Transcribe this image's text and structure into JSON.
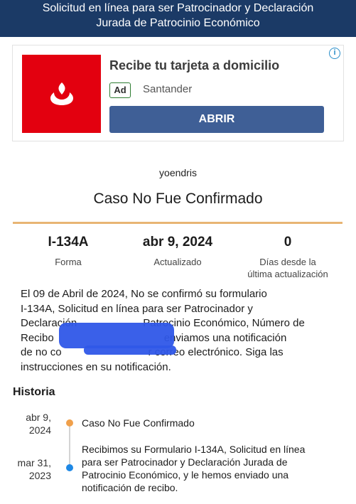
{
  "header": {
    "title_line1": "Solicitud en línea para ser Patrocinador y Declaración",
    "title_line2": "Jurada de Patrocinio Económico"
  },
  "ad": {
    "title": "Recibe tu tarjeta a domicilio",
    "badge": "Ad",
    "brand": "Santander",
    "button_label": "ABRIR",
    "info_icon": "i",
    "logo_color": "#e3000f",
    "button_color": "#3f5f96"
  },
  "case": {
    "username": "yoendris",
    "status_title": "Caso No Fue Confirmado",
    "accent_color": "#e8b574"
  },
  "stats": [
    {
      "value": "I-134A",
      "label": "Forma"
    },
    {
      "value": "abr 9, 2024",
      "label": "Actualizado"
    },
    {
      "value": "0",
      "label_line1": "Días desde la",
      "label_line2": "última actualización"
    }
  ],
  "description": {
    "line1": "El 09 de Abril de 2024, No se confirmó su formulario",
    "line2": "I-134A, Solicitud en línea para ser Patrocinador y",
    "line3_a": "Declaración",
    "line3_b": "Patrocinio Económico, Número de",
    "line4_a": "Recibo",
    "line4_b": "enviamos una notificación",
    "line5_a": "de no co",
    "line5_b": "r correo electrónico. Siga las",
    "line6": "instrucciones en su notificación."
  },
  "history": {
    "heading": "Historia",
    "items": [
      {
        "date_line1": "abr 9,",
        "date_line2": "2024",
        "text": "Caso No Fue Confirmado",
        "dot_color": "#f0a04b"
      },
      {
        "date_line1": "mar 31,",
        "date_line2": "2023",
        "text_line1": "Recibimos su Formulario I-134A, Solicitud en línea",
        "text_line2": "para ser Patrocinador y Declaración Jurada de",
        "text_line3": "Patrocinio Económico, y le hemos enviado una",
        "text_line4": "notificación de recibo.",
        "dot_color": "#1e88e5"
      }
    ]
  }
}
